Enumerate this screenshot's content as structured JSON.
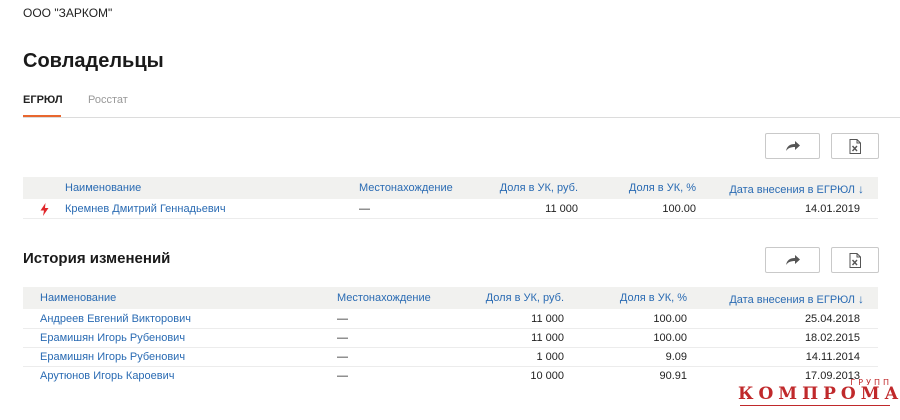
{
  "company_name": "ООО \"ЗАРКОМ\"",
  "page_title": "Совладельцы",
  "tabs": [
    {
      "label": "ЕГРЮЛ",
      "active": true
    },
    {
      "label": "Росстат",
      "active": false
    }
  ],
  "toolbar_icons": [
    "share-icon",
    "excel-icon"
  ],
  "owners": {
    "columns": {
      "name": "Наименование",
      "location": "Местонахождение",
      "share_rub": "Доля в УК, руб.",
      "share_pct": "Доля в УК, %",
      "date": "Дата внесения в ЕГРЮЛ",
      "sort_arrow": "↓"
    },
    "rows": [
      {
        "name": "Кремнев Дмитрий Геннадьевич",
        "location": "—",
        "share_rub": "11 000",
        "share_pct": "100.00",
        "date": "14.01.2019"
      }
    ]
  },
  "history": {
    "title": "История изменений",
    "columns": {
      "name": "Наименование",
      "location": "Местонахождение",
      "share_rub": "Доля в УК, руб.",
      "share_pct": "Доля в УК, %",
      "date": "Дата внесения в ЕГРЮЛ",
      "sort_arrow": "↓"
    },
    "rows": [
      {
        "name": "Андреев Евгений Викторович",
        "location": "—",
        "share_rub": "11 000",
        "share_pct": "100.00",
        "date": "25.04.2018"
      },
      {
        "name": "Ерамишян Игорь Рубенович",
        "location": "—",
        "share_rub": "11 000",
        "share_pct": "100.00",
        "date": "18.02.2015"
      },
      {
        "name": "Ерамишян Игорь Рубенович",
        "location": "—",
        "share_rub": "1 000",
        "share_pct": "9.09",
        "date": "14.11.2014"
      },
      {
        "name": "Арутюнов Игорь Кароевич",
        "location": "—",
        "share_rub": "10 000",
        "share_pct": "90.91",
        "date": "17.09.2013"
      }
    ]
  },
  "watermark": {
    "main": "КОМПРОМАТ",
    "sub": "ГРУПП"
  },
  "colors": {
    "accent": "#e8672f",
    "link": "#2a6bb3",
    "alert": "#e0272b",
    "watermark": "#c0292b"
  }
}
